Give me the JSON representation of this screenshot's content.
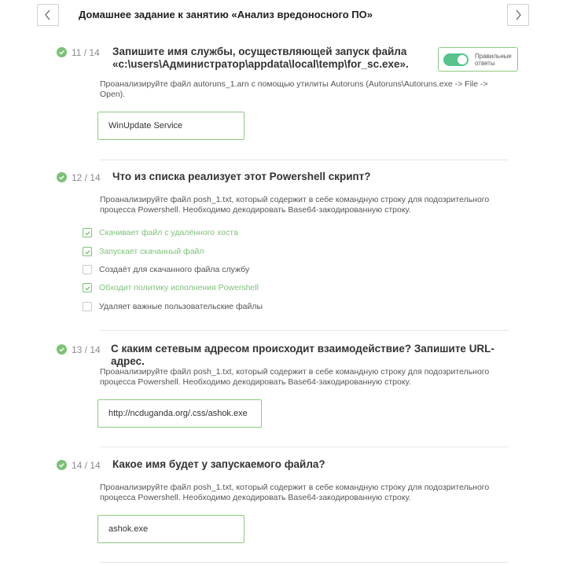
{
  "header": {
    "title": "Домашнее задание к занятию «Анализ вредоносного ПО»",
    "prev_icon": "chevron-left-icon",
    "next_icon": "chevron-right-icon"
  },
  "toggle": {
    "label_line1": "Правильные",
    "label_line2": "ответы",
    "on": true,
    "color": "#57c48c"
  },
  "colors": {
    "accent": "#7cc277",
    "field_border": "#8cc97f"
  },
  "questions": [
    {
      "number": "11 / 14",
      "title_line1": "Запишите имя службы, осуществляющей запуск файла",
      "title_line2": "«c:\\users\\Администратор\\appdata\\local\\temp\\for_sc.exe».",
      "desc_line1": "Проанализируйте файл autoruns_1.arn с помощью утилиты Autoruns (Autoruns\\Autoruns.exe -> File ->",
      "desc_line2": "Open).",
      "answer": "WinUpdate Service"
    },
    {
      "number": "12 / 14",
      "title": "Что из списка реализует этот Powershell скрипт?",
      "desc_line1": "Проанализируйте файл posh_1.txt, который содержит в себе командную строку для подозрительного",
      "desc_line2": "процесса Powershell. Необходимо декодировать Base64-закодированную строку.",
      "options": [
        {
          "label": "Скачивает файл с удалённого хоста",
          "checked": true
        },
        {
          "label": "Запускает скачанный файл",
          "checked": true
        },
        {
          "label": "Создаёт для скачанного файла службу",
          "checked": false
        },
        {
          "label": "Обходит политику исполнения Powershell",
          "checked": true
        },
        {
          "label": "Удаляет важные пользовательские файлы",
          "checked": false
        }
      ]
    },
    {
      "number": "13 / 14",
      "title": "С каким сетевым адресом происходит взаимодействие? Запишите URL-адрес.",
      "desc_line1": "Проанализируйте файл posh_1.txt, который содержит в себе командную строку для подозрительного",
      "desc_line2": "процесса Powershell. Необходимо декодировать Base64-закодированную строку.",
      "answer": "http://ncduganda.org/.css/ashok.exe"
    },
    {
      "number": "14 / 14",
      "title": "Какое имя будет у запускаемого файла?",
      "desc_line1": "Проанализируйте файл posh_1.txt, который содержит в себе командную строку для подозрительного",
      "desc_line2": "процесса Powershell. Необходимо декодировать Base64-закодированную строку.",
      "answer": "ashok.exe"
    }
  ]
}
